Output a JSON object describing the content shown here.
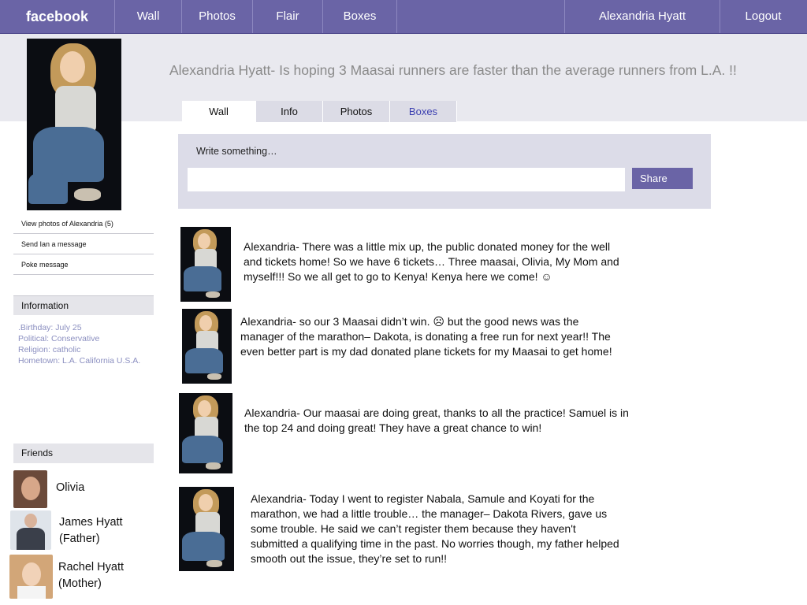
{
  "nav": {
    "brand": "facebook",
    "items": [
      "Wall",
      "Photos",
      "Flair",
      "Boxes"
    ],
    "user": "Alexandria Hyatt",
    "logout": "Logout"
  },
  "profile": {
    "status": "Alexandria Hyatt- Is hoping 3 Maasai runners are faster than the average runners from L.A. !!",
    "tabs": [
      "Wall",
      "Info",
      "Photos",
      "Boxes"
    ],
    "active_tab": "Wall"
  },
  "sidebar": {
    "links": [
      "View photos of Alexandria (5)",
      "Send Ian a message",
      "Poke message"
    ],
    "info_title": "Information",
    "info_lines": [
      ".Birthday: July 25",
      "Political: Conservative",
      "Religion:  catholic",
      "Hometown: L.A. California  U.S.A."
    ],
    "friends_title": "Friends",
    "friends": [
      {
        "name_line1": "Olivia",
        "name_line2": ""
      },
      {
        "name_line1": "James Hyatt",
        "name_line2": "(Father)"
      },
      {
        "name_line1": "Rachel Hyatt",
        "name_line2": "(Mother)"
      }
    ]
  },
  "composer": {
    "label": "Write something…",
    "value": "",
    "share": "Share"
  },
  "posts": [
    {
      "lines": [
        "Alexandria- There was a little mix up, the public donated money for the well",
        "and tickets home! So we have 6 tickets… Three maasai, Olivia, My Mom and",
        "myself!!! So we all get to go to Kenya! Kenya here we come! ☺"
      ]
    },
    {
      "lines": [
        "Alexandria- so our 3 Maasai didn’t win. ☹ but the good news was the",
        "manager of the marathon– Dakota, is donating a free run for next year!! The",
        "even better part is my dad donated plane tickets for my Maasai to get home!"
      ]
    },
    {
      "lines": [
        "Alexandria- Our maasai are doing great, thanks to all the practice! Samuel is in",
        "the top 24 and doing great! They have a great chance to win!"
      ]
    },
    {
      "lines": [
        "Alexandria-  Today I went  to register Nabala, Samule and Koyati for the",
        "marathon, we had a little trouble… the manager– Dakota Rivers,   gave us",
        "some trouble. He said we can’t register them because they haven't",
        "submitted a qualifying time in the past.  No worries though, my father helped",
        "smooth out the issue, they’re set to run!!"
      ]
    }
  ],
  "colors": {
    "nav_bg": "#6a64a6",
    "band_bg": "#e9e9ef",
    "composer_bg": "#dcdce8",
    "info_text": "#8b8fc0",
    "tab_blue": "#3b3fb0"
  }
}
